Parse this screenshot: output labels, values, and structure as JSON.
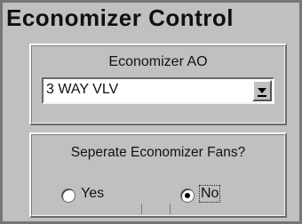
{
  "window": {
    "title": "Economizer Control"
  },
  "ao_group": {
    "label": "Economizer AO",
    "selected_value": "3 WAY VLV",
    "dropdown_icon": "chevron-down-icon"
  },
  "fans_group": {
    "question": "Seperate Economizer Fans?",
    "options": [
      {
        "label": "Yes",
        "selected": false
      },
      {
        "label": "No",
        "selected": true
      }
    ]
  },
  "colors": {
    "panel_background": "#c0c0c0",
    "frame": "#808080"
  }
}
